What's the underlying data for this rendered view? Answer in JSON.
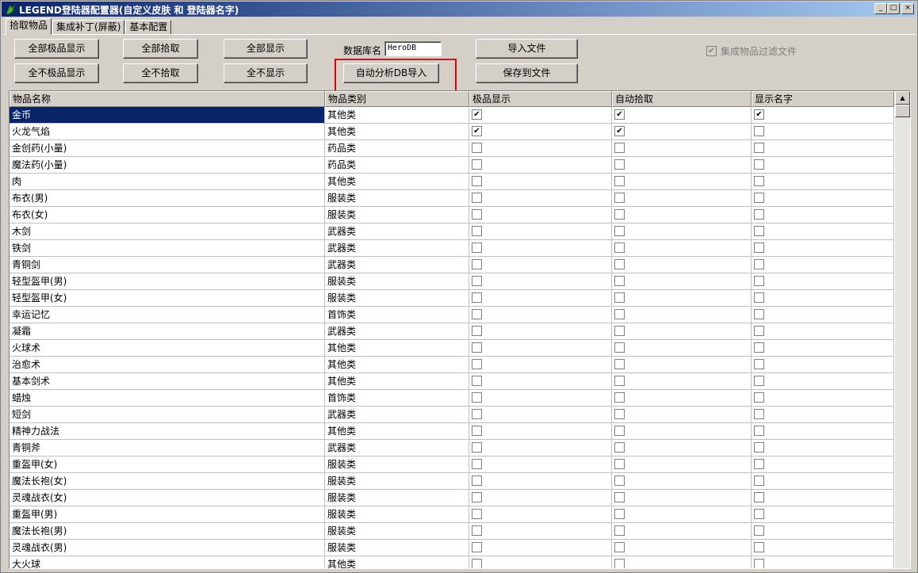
{
  "window": {
    "title": "LEGEND登陆器配置器(自定义皮肤 和 登陆器名字)",
    "min_label": "_",
    "max_label": "□",
    "close_label": "×"
  },
  "tabs": [
    {
      "label": "拾取物品"
    },
    {
      "label": "集成补丁(屏蔽)"
    },
    {
      "label": "基本配置"
    }
  ],
  "toolbar": {
    "all_top_show": "全部极品显示",
    "all_pick": "全部拾取",
    "all_show": "全部显示",
    "none_top_show": "全不极品显示",
    "none_pick": "全不拾取",
    "none_show": "全不显示",
    "db_label": "数据库名",
    "db_value": "HeroDB",
    "import_file": "导入文件",
    "auto_import_db": "自动分析DB导入",
    "save_to_file": "保存到文件",
    "filter_label": "集成物品过滤文件",
    "filter_check": "✔"
  },
  "table": {
    "columns": [
      "物品名称",
      "物品类别",
      "极品显示",
      "自动拾取",
      "显示名字"
    ],
    "rows": [
      {
        "name": "金币",
        "type": "其他类",
        "top": true,
        "pick": true,
        "show": true,
        "selected": true
      },
      {
        "name": "火龙气焰",
        "type": "其他类",
        "top": true,
        "pick": true,
        "show": false
      },
      {
        "name": "金创药(小量)",
        "type": "药品类",
        "top": false,
        "pick": false,
        "show": false
      },
      {
        "name": "魔法药(小量)",
        "type": "药品类",
        "top": false,
        "pick": false,
        "show": false
      },
      {
        "name": "肉",
        "type": "其他类",
        "top": false,
        "pick": false,
        "show": false
      },
      {
        "name": "布衣(男)",
        "type": "服装类",
        "top": false,
        "pick": false,
        "show": false
      },
      {
        "name": "布衣(女)",
        "type": "服装类",
        "top": false,
        "pick": false,
        "show": false
      },
      {
        "name": "木剑",
        "type": "武器类",
        "top": false,
        "pick": false,
        "show": false
      },
      {
        "name": "铁剑",
        "type": "武器类",
        "top": false,
        "pick": false,
        "show": false
      },
      {
        "name": "青铜剑",
        "type": "武器类",
        "top": false,
        "pick": false,
        "show": false
      },
      {
        "name": "轻型盔甲(男)",
        "type": "服装类",
        "top": false,
        "pick": false,
        "show": false
      },
      {
        "name": "轻型盔甲(女)",
        "type": "服装类",
        "top": false,
        "pick": false,
        "show": false
      },
      {
        "name": "幸运记忆",
        "type": "首饰类",
        "top": false,
        "pick": false,
        "show": false
      },
      {
        "name": "凝霜",
        "type": "武器类",
        "top": false,
        "pick": false,
        "show": false
      },
      {
        "name": "火球术",
        "type": "其他类",
        "top": false,
        "pick": false,
        "show": false
      },
      {
        "name": "治愈术",
        "type": "其他类",
        "top": false,
        "pick": false,
        "show": false
      },
      {
        "name": "基本剑术",
        "type": "其他类",
        "top": false,
        "pick": false,
        "show": false
      },
      {
        "name": "蜡烛",
        "type": "首饰类",
        "top": false,
        "pick": false,
        "show": false
      },
      {
        "name": "短剑",
        "type": "武器类",
        "top": false,
        "pick": false,
        "show": false
      },
      {
        "name": "精神力战法",
        "type": "其他类",
        "top": false,
        "pick": false,
        "show": false
      },
      {
        "name": "青铜斧",
        "type": "武器类",
        "top": false,
        "pick": false,
        "show": false
      },
      {
        "name": "重盔甲(女)",
        "type": "服装类",
        "top": false,
        "pick": false,
        "show": false
      },
      {
        "name": "魔法长袍(女)",
        "type": "服装类",
        "top": false,
        "pick": false,
        "show": false
      },
      {
        "name": "灵魂战衣(女)",
        "type": "服装类",
        "top": false,
        "pick": false,
        "show": false
      },
      {
        "name": "重盔甲(男)",
        "type": "服装类",
        "top": false,
        "pick": false,
        "show": false
      },
      {
        "name": "魔法长袍(男)",
        "type": "服装类",
        "top": false,
        "pick": false,
        "show": false
      },
      {
        "name": "灵魂战衣(男)",
        "type": "服装类",
        "top": false,
        "pick": false,
        "show": false
      },
      {
        "name": "大火球",
        "type": "其他类",
        "top": false,
        "pick": false,
        "show": false
      }
    ]
  },
  "scrollbar": {
    "up": "▲"
  }
}
